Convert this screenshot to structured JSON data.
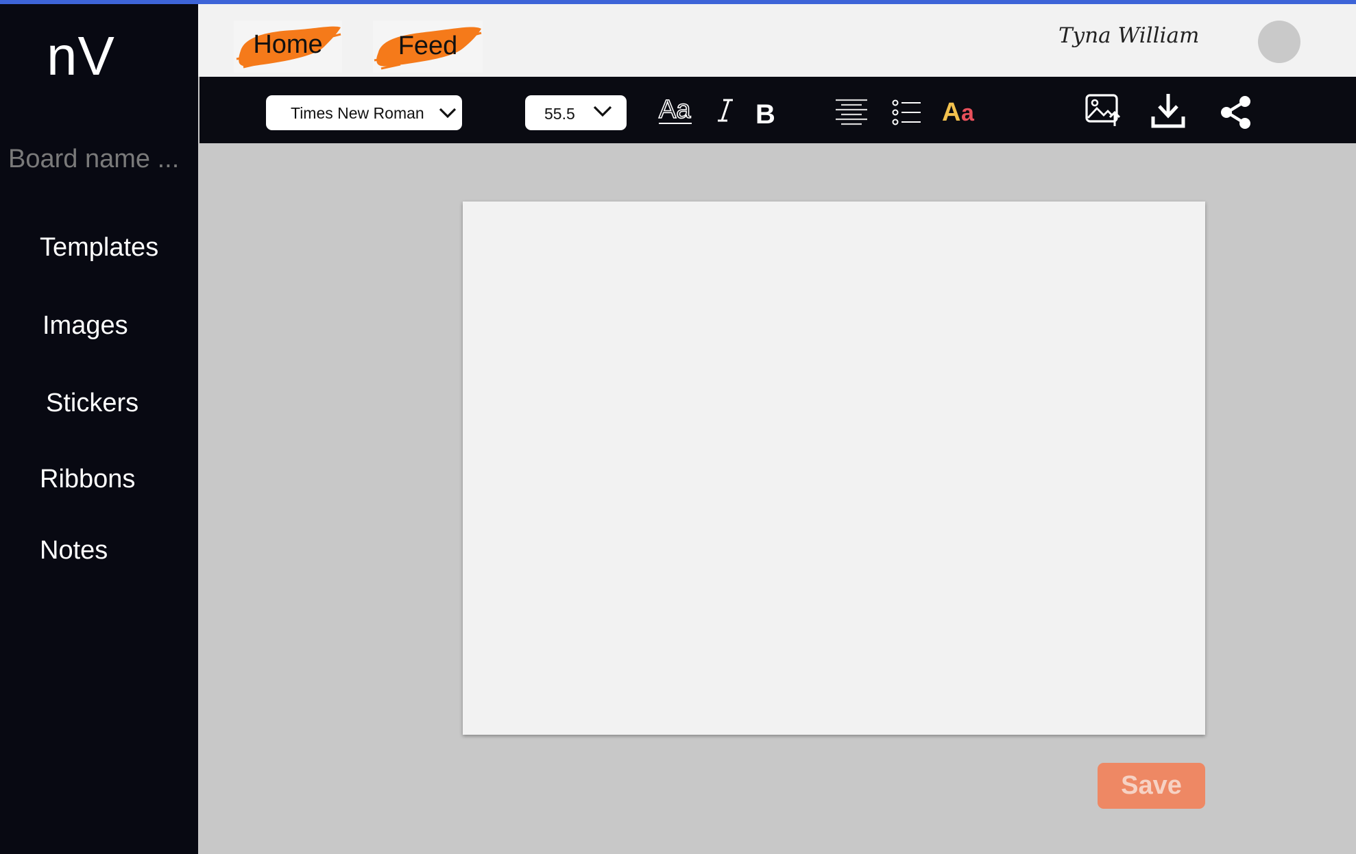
{
  "app": {
    "logo": "nV"
  },
  "sidebar": {
    "board_name_placeholder": "Board name ...",
    "items": [
      {
        "label": "Templates"
      },
      {
        "label": "Images"
      },
      {
        "label": "Stickers"
      },
      {
        "label": "Ribbons"
      },
      {
        "label": "Notes"
      }
    ]
  },
  "header": {
    "tabs": [
      {
        "label": "Home"
      },
      {
        "label": "Feed"
      }
    ],
    "username": "Tyna William",
    "tab_highlight_color": "#f57a1a"
  },
  "toolbar": {
    "font_family": {
      "value": "Times New Roman",
      "icon": "chevron-down-icon"
    },
    "font_size": {
      "value": "55.5",
      "icon": "chevron-down-icon"
    },
    "text_format": [
      {
        "icon": "text-style-icon",
        "glyph": "Aa"
      },
      {
        "icon": "italic-icon",
        "glyph": "I"
      },
      {
        "icon": "bold-icon",
        "glyph": "B"
      }
    ],
    "paragraph": [
      {
        "icon": "align-center-icon"
      },
      {
        "icon": "bullet-list-icon"
      },
      {
        "icon": "text-color-icon",
        "glyph_upper": "A",
        "glyph_lower": "a",
        "color_upper": "#f2c14e",
        "color_lower": "#e8505b"
      }
    ],
    "actions": [
      {
        "icon": "upload-image-icon"
      },
      {
        "icon": "download-icon"
      },
      {
        "icon": "share-icon"
      }
    ]
  },
  "canvas": {
    "background": "#f2f2f2"
  },
  "save_button": {
    "label": "Save",
    "color": "#ee8864"
  },
  "colors": {
    "sidebar_bg": "#080912",
    "header_bg": "#f2f2f2",
    "workspace_bg": "#c8c8c8",
    "top_accent": "#3d64d8"
  }
}
